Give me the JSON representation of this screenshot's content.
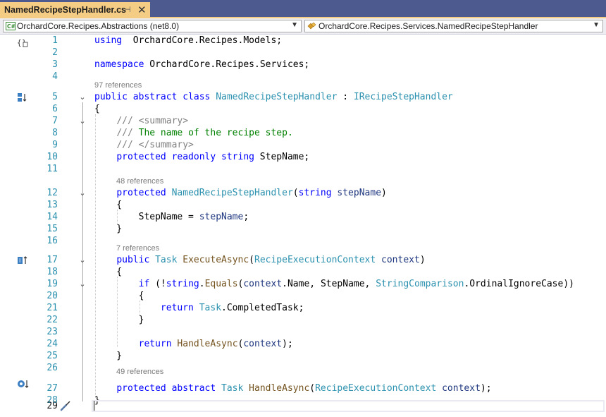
{
  "tab": {
    "title": "NamedRecipeStepHandler.cs",
    "pin_glyph": "⊣",
    "close_glyph": "✕"
  },
  "navbar": {
    "project": "OrchardCore.Recipes.Abstractions (net8.0)",
    "type": "OrchardCore.Recipes.Services.NamedRecipeStepHandler",
    "project_icon": "csharp-project-icon",
    "type_icon": "class-icon"
  },
  "references": {
    "class": "97 references",
    "field": "48 references",
    "execute": "7 references",
    "handle": "49 references"
  },
  "lines": [
    {
      "n": "1",
      "tokens": [
        [
          "kw",
          "using"
        ],
        [
          "",
          "  OrchardCore.Recipes.Models;"
        ]
      ]
    },
    {
      "n": "2",
      "tokens": []
    },
    {
      "n": "3",
      "tokens": [
        [
          "kw",
          "namespace"
        ],
        [
          "",
          " OrchardCore.Recipes.Services;"
        ]
      ]
    },
    {
      "n": "4",
      "tokens": []
    },
    {
      "n": "5",
      "tokens": [
        [
          "kw",
          "public abstract class"
        ],
        [
          "",
          " "
        ],
        [
          "ty",
          "NamedRecipeStepHandler"
        ],
        [
          "",
          " : "
        ],
        [
          "ty",
          "IRecipeStepHandler"
        ]
      ]
    },
    {
      "n": "6",
      "tokens": [
        [
          "",
          "{"
        ]
      ]
    },
    {
      "n": "7",
      "tokens": [
        [
          "",
          "    "
        ],
        [
          "xd",
          "/// <summary>"
        ]
      ]
    },
    {
      "n": "8",
      "tokens": [
        [
          "",
          "    "
        ],
        [
          "xd",
          "///"
        ],
        [
          "cm",
          " The name of the recipe step."
        ]
      ]
    },
    {
      "n": "9",
      "tokens": [
        [
          "",
          "    "
        ],
        [
          "xd",
          "/// </summary>"
        ]
      ]
    },
    {
      "n": "10",
      "tokens": [
        [
          "",
          "    "
        ],
        [
          "kw",
          "protected readonly string"
        ],
        [
          "",
          " StepName;"
        ]
      ]
    },
    {
      "n": "11",
      "tokens": []
    },
    {
      "n": "12",
      "tokens": [
        [
          "",
          "    "
        ],
        [
          "kw",
          "protected"
        ],
        [
          "",
          " "
        ],
        [
          "ty",
          "NamedRecipeStepHandler"
        ],
        [
          "",
          "("
        ],
        [
          "kw",
          "string"
        ],
        [
          "",
          " "
        ],
        [
          "pr",
          "stepName"
        ],
        [
          "",
          ")"
        ]
      ]
    },
    {
      "n": "13",
      "tokens": [
        [
          "",
          "    {"
        ]
      ]
    },
    {
      "n": "14",
      "tokens": [
        [
          "",
          "        StepName = "
        ],
        [
          "pr",
          "stepName"
        ],
        [
          "",
          ";"
        ]
      ]
    },
    {
      "n": "15",
      "tokens": [
        [
          "",
          "    }"
        ]
      ]
    },
    {
      "n": "16",
      "tokens": []
    },
    {
      "n": "17",
      "tokens": [
        [
          "",
          "    "
        ],
        [
          "kw",
          "public"
        ],
        [
          "",
          " "
        ],
        [
          "ty",
          "Task"
        ],
        [
          "",
          " "
        ],
        [
          "mt",
          "ExecuteAsync"
        ],
        [
          "",
          "("
        ],
        [
          "ty",
          "RecipeExecutionContext"
        ],
        [
          "",
          " "
        ],
        [
          "pr",
          "context"
        ],
        [
          "",
          ")"
        ]
      ]
    },
    {
      "n": "18",
      "tokens": [
        [
          "",
          "    {"
        ]
      ]
    },
    {
      "n": "19",
      "tokens": [
        [
          "",
          "        "
        ],
        [
          "kw",
          "if"
        ],
        [
          "",
          " (!"
        ],
        [
          "kw",
          "string"
        ],
        [
          "",
          "."
        ],
        [
          "mt",
          "Equals"
        ],
        [
          "",
          "("
        ],
        [
          "pr",
          "context"
        ],
        [
          "",
          ".Name, StepName, "
        ],
        [
          "ty",
          "StringComparison"
        ],
        [
          "",
          ".OrdinalIgnoreCase))"
        ]
      ]
    },
    {
      "n": "20",
      "tokens": [
        [
          "",
          "        {"
        ]
      ]
    },
    {
      "n": "21",
      "tokens": [
        [
          "",
          "            "
        ],
        [
          "kw",
          "return"
        ],
        [
          "",
          " "
        ],
        [
          "ty",
          "Task"
        ],
        [
          "",
          ".CompletedTask;"
        ]
      ]
    },
    {
      "n": "22",
      "tokens": [
        [
          "",
          "        }"
        ]
      ]
    },
    {
      "n": "23",
      "tokens": []
    },
    {
      "n": "24",
      "tokens": [
        [
          "",
          "        "
        ],
        [
          "kw",
          "return"
        ],
        [
          "",
          " "
        ],
        [
          "mt",
          "HandleAsync"
        ],
        [
          "",
          "("
        ],
        [
          "pr",
          "context"
        ],
        [
          "",
          ");"
        ]
      ]
    },
    {
      "n": "25",
      "tokens": [
        [
          "",
          "    }"
        ]
      ]
    },
    {
      "n": "26",
      "tokens": []
    },
    {
      "n": "27",
      "tokens": [
        [
          "",
          "    "
        ],
        [
          "kw",
          "protected abstract"
        ],
        [
          "",
          " "
        ],
        [
          "ty",
          "Task"
        ],
        [
          "",
          " "
        ],
        [
          "mt",
          "HandleAsync"
        ],
        [
          "",
          "("
        ],
        [
          "ty",
          "RecipeExecutionContext"
        ],
        [
          "",
          " "
        ],
        [
          "pr",
          "context"
        ],
        [
          "",
          ");"
        ]
      ]
    },
    {
      "n": "28",
      "tokens": [
        [
          "",
          "}"
        ]
      ]
    },
    {
      "n": "29",
      "tokens": []
    }
  ],
  "colors": {
    "keyword": "#0000ff",
    "type": "#2b91af",
    "comment": "#008000",
    "xmldoc": "#808080",
    "method": "#74531f",
    "param": "#1f377f",
    "linenumber": "#2b91af",
    "tab_active": "#f5cc84",
    "tabstrip": "#4d5a8f"
  }
}
